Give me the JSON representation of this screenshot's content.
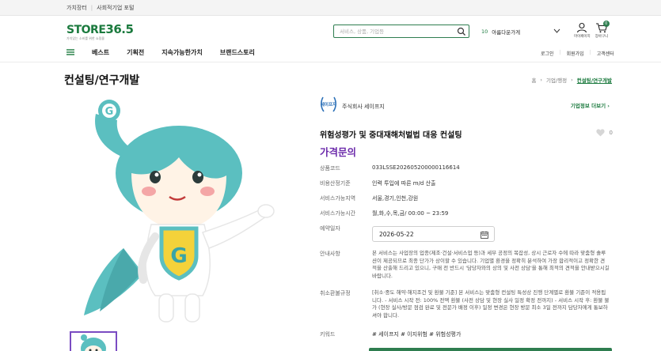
{
  "topbar": {
    "links": [
      "가치장터",
      "사회적기업 포털"
    ]
  },
  "logo": {
    "text_a": "STORE",
    "text_b": "36.5",
    "tagline": "가치있는 소비를 위한 쇼핑몰"
  },
  "search": {
    "placeholder": "서비스, 상품, 기업등"
  },
  "ranking": {
    "num": "10",
    "label": "아름다운가게"
  },
  "user_menu": {
    "mypage": "마이페이지",
    "cart": "장바구니",
    "cart_count": "0"
  },
  "nav": {
    "items": [
      "베스트",
      "기획전",
      "지속가능한가치",
      "브랜드스토리"
    ],
    "login": "로그인",
    "join": "회원가입",
    "support": "고객센터"
  },
  "page": {
    "title": "컨설팅/연구개발"
  },
  "breadcrumb": [
    "홈",
    "기업/행정",
    "컨설팅/연구개발"
  ],
  "company": {
    "name": "주식회사 세이프지",
    "logo_text": "세이프지",
    "link": "기업정보 더보기"
  },
  "product": {
    "title": "위험성평가 및 중대재해처벌법 대응 컨설팅",
    "likes": "0",
    "price": "가격문의",
    "code_label": "상품코드",
    "code": "033LSSE202605200000116614",
    "cost_label": "비용산정기준",
    "cost": "인력 투입에 따른 m/d 산출",
    "region_label": "서비스가능지역",
    "region": "서울,경기,인천,강원",
    "time_label": "서비스가능시간",
    "time": "월,화,수,목,금/ 00:00 ~ 23:59",
    "date_label": "예약일자",
    "date": "2026-05-22",
    "notice_label": "안내사항",
    "notice": "본 서비스는 사업장의 업종(제조·건설·서비스업 등)과 세부 공정의 복잡성, 상시 근로자 수에 따라 맞춤형 솔루션이 제공되므로 최종 단가가 상이할 수 있습니다. 기업별 환경을 정확히 분석하여 가장 합리적이고 정확한 견적을 산출해 드리고 있으니, 구매 전 반드시 '담당자와의 상의 및 사전 상담'을 통해 최적의 견적을 안내받으시길 바랍니다.",
    "refund_label": "취소환불규정",
    "refund": "[취소·중도 해약·해지조건 및 환불 기준] 본 서비스는 맞춤형 컨설팅 특성상 진행 단계별로 환불 기준이 적용됩니다. - 서비스 시작 전: 100% 전액 환불 (사전 상담 및 현장 실사 일정 확정 전까지) - 서비스 시작 후: 환불 불가 (현장 실사/방문 점검 완료 및 전문가 배정 이후) 일정 변경은 현장 방문 최소 3일 전까지 담당자에게 통보하셔야 합니다.",
    "keyword_label": "키워드",
    "keywords": "# 세이프지 # 이지위험 # 위험성평가"
  },
  "colors": {
    "brand_green": "#1b7a3e",
    "price_purple": "#6c2bab",
    "mascot_teal": "#5bbfc0",
    "badge_yellow": "#f4d23a"
  }
}
